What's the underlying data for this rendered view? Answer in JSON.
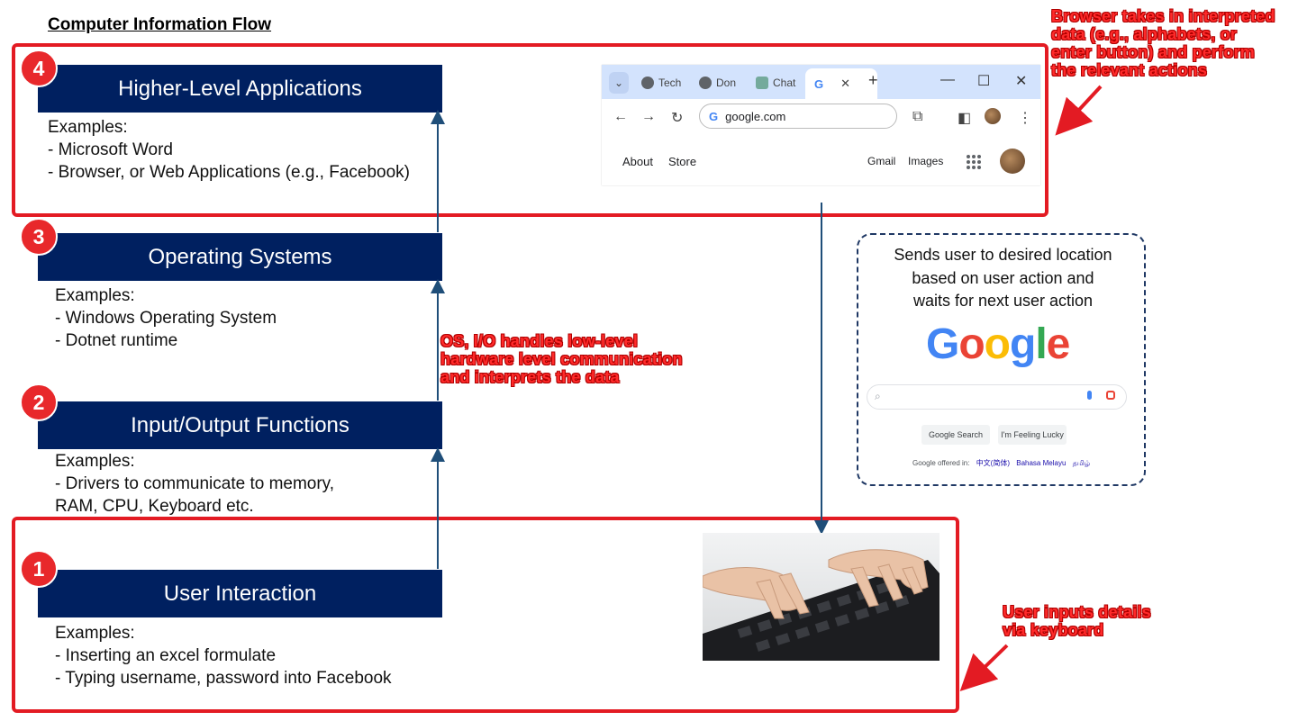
{
  "title": "Computer Information Flow",
  "layers": [
    {
      "num": "4",
      "label": "Higher-Level Applications",
      "examples": [
        "Examples:",
        "- Microsoft Word",
        "- Browser, or Web Applications (e.g., Facebook)"
      ]
    },
    {
      "num": "3",
      "label": "Operating Systems",
      "examples": [
        "Examples:",
        "- Windows Operating System",
        "- Dotnet runtime"
      ]
    },
    {
      "num": "2",
      "label": "Input/Output Functions",
      "examples": [
        "Examples:",
        "- Drivers to communicate to memory,",
        "RAM, CPU, Keyboard etc."
      ]
    },
    {
      "num": "1",
      "label": "User Interaction",
      "examples": [
        "Examples:",
        "- Inserting an excel formulate",
        "- Typing username, password into Facebook"
      ]
    }
  ],
  "annotations": {
    "browser": [
      "Browser takes in interpreted",
      "data (e.g., alphabets, or",
      "enter button) and perform",
      "the relevant actions"
    ],
    "os": [
      "OS, I/O handles low-level",
      "hardware level communication",
      "and interprets the data"
    ],
    "user": [
      "User inputs details",
      "via keyboard"
    ]
  },
  "browser": {
    "tabs": [
      "Tech",
      "Don",
      "Chat"
    ],
    "new_tab": "+",
    "close_tab": "✕",
    "url": "google.com",
    "links_left": [
      "About",
      "Store"
    ],
    "links_right": [
      "Gmail",
      "Images"
    ],
    "win_controls": [
      "—",
      "☐",
      "✕"
    ]
  },
  "google_card": {
    "caption": [
      "Sends user to desired location",
      "based on user action and",
      "waits for next user action"
    ],
    "logo_letters": [
      {
        "ch": "G",
        "color": "#4285F4"
      },
      {
        "ch": "o",
        "color": "#EA4335"
      },
      {
        "ch": "o",
        "color": "#FBBC05"
      },
      {
        "ch": "g",
        "color": "#4285F4"
      },
      {
        "ch": "l",
        "color": "#34A853"
      },
      {
        "ch": "e",
        "color": "#EA4335"
      }
    ],
    "search_button": "Google Search",
    "lucky_button": "I'm Feeling Lucky",
    "offered_in": "Google offered in:",
    "languages": [
      "中文(简体)",
      "Bahasa Melayu",
      "தமிழ்"
    ]
  },
  "colors": {
    "layer_fill": "#002060",
    "badge": "#e8282b",
    "frame": "#e31b23",
    "arrow": "#1f4e79"
  }
}
